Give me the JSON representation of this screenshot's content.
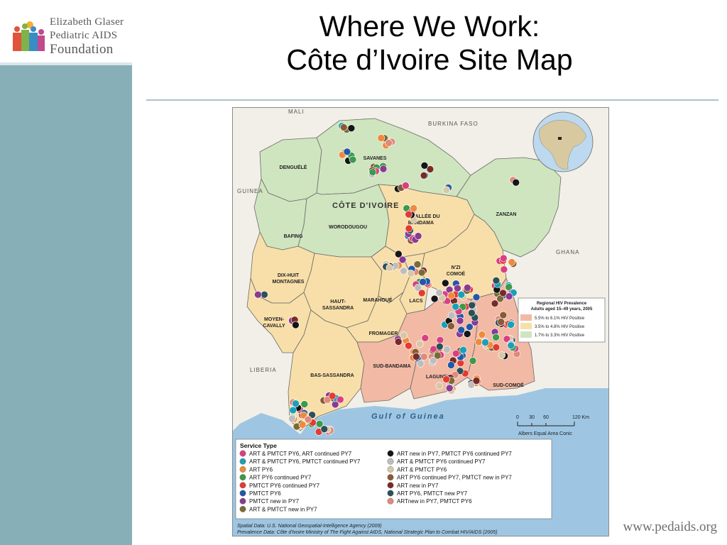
{
  "logo": {
    "line1": "Elizabeth Glaser",
    "line2": "Pediatric AIDS",
    "line3": "Foundation"
  },
  "title": {
    "line1": "Where We Work:",
    "line2": "Côte d’Ivoire Site Map"
  },
  "footer_url": "www.pedaids.org",
  "map": {
    "neighbors": {
      "mali": "MALI",
      "burkina": "BURKINA FASO",
      "guinea": "GUINEA",
      "ghana": "GHANA",
      "liberia": "LIBERIA"
    },
    "country_label": "CÔTE D'IVOIRE",
    "sea_label": "Gulf of Guinea",
    "regions": {
      "denguele": "DENGUÉLÉ",
      "savanes": "SAVANES",
      "zanzan": "ZANZAN",
      "bafing": "BAFING",
      "worodougou": "WORODOUGOU",
      "vallee1": "VALLÉE DU",
      "vallee2": "BANDAMA",
      "dixhuit1": "DIX-HUIT",
      "dixhuit2": "MONTAGNES",
      "nzi1": "N'ZI",
      "nzi2": "COMOÉ",
      "haut1": "HAUT-",
      "haut2": "SASSANDRA",
      "marahoue": "MARAHOUÉ",
      "lacs": "LACS",
      "moyen1": "MOYEN-",
      "moyen2": "CAVALLY",
      "fromager": "FROMAGER",
      "sudbandama": "SUD-BANDAMA",
      "lagunes": "LAGUNES",
      "sudcomoe": "SUD-COMOÉ",
      "bassassandra": "BAS-SASSANDRA"
    },
    "prevalence_legend": {
      "title1": "Regional HIV Prevalence",
      "title2": "Adults aged 15–49 years, 2005",
      "items": [
        {
          "label": "5.5% to 6.1% HIV Positive",
          "color": "#f2b9a4"
        },
        {
          "label": "3.5% to 4.8% HIV Positive",
          "color": "#f8dfa9"
        },
        {
          "label": "1.7% to 3.3% HIV Positive",
          "color": "#cfe5bf"
        }
      ]
    },
    "scale": {
      "ticks": [
        "0",
        "30",
        "60",
        "120 Km"
      ],
      "projection": "Albers Equal Area Conic"
    },
    "service_legend": {
      "title": "Service Type",
      "items": [
        {
          "label": "ART & PMTCT PY6, ART continued PY7",
          "color": "#d9407f"
        },
        {
          "label": "ART & PMTCT PY6, PMTCT continued PY7",
          "color": "#1aa0b6"
        },
        {
          "label": "ART PY6",
          "color": "#ef8a3c"
        },
        {
          "label": "ART PY6 continued PY7",
          "color": "#3c9a48"
        },
        {
          "label": "PMTCT PY6 continued PY7",
          "color": "#e33b32"
        },
        {
          "label": "PMTCT PY6",
          "color": "#2358a6"
        },
        {
          "label": "PMTCT new in PY7",
          "color": "#8a3a92"
        },
        {
          "label": "ART & PMTCT new in PY7",
          "color": "#7a6a36"
        },
        {
          "label": "ART new in PY7, PMTCT PY6 continued PY7",
          "color": "#151515"
        },
        {
          "label": "ART & PMTCT PY6 continued PY7",
          "color": "#bdbdbd"
        },
        {
          "label": "ART & PMTCT PY6",
          "color": "#d8c7a6"
        },
        {
          "label": "ART PY6 continued PY7, PMTCT new in PY7",
          "color": "#8a5a34"
        },
        {
          "label": "ART new in PY7",
          "color": "#7a2a26"
        },
        {
          "label": "ART PY6, PMTCT new PY7",
          "color": "#2d5058"
        },
        {
          "label": "ARTnew in PY7, PMTCT PY6",
          "color": "#e08a7a"
        }
      ]
    },
    "sources": {
      "line1": "Spatial Data: U.S. National Geospatial-Intelligence Agency (2009)",
      "line2": "Prevalence Data: Côte d'Ivoire Ministry of The Fight Against AIDS, National Strategic Plan to Combat HIV/AIDS (2005)"
    }
  }
}
